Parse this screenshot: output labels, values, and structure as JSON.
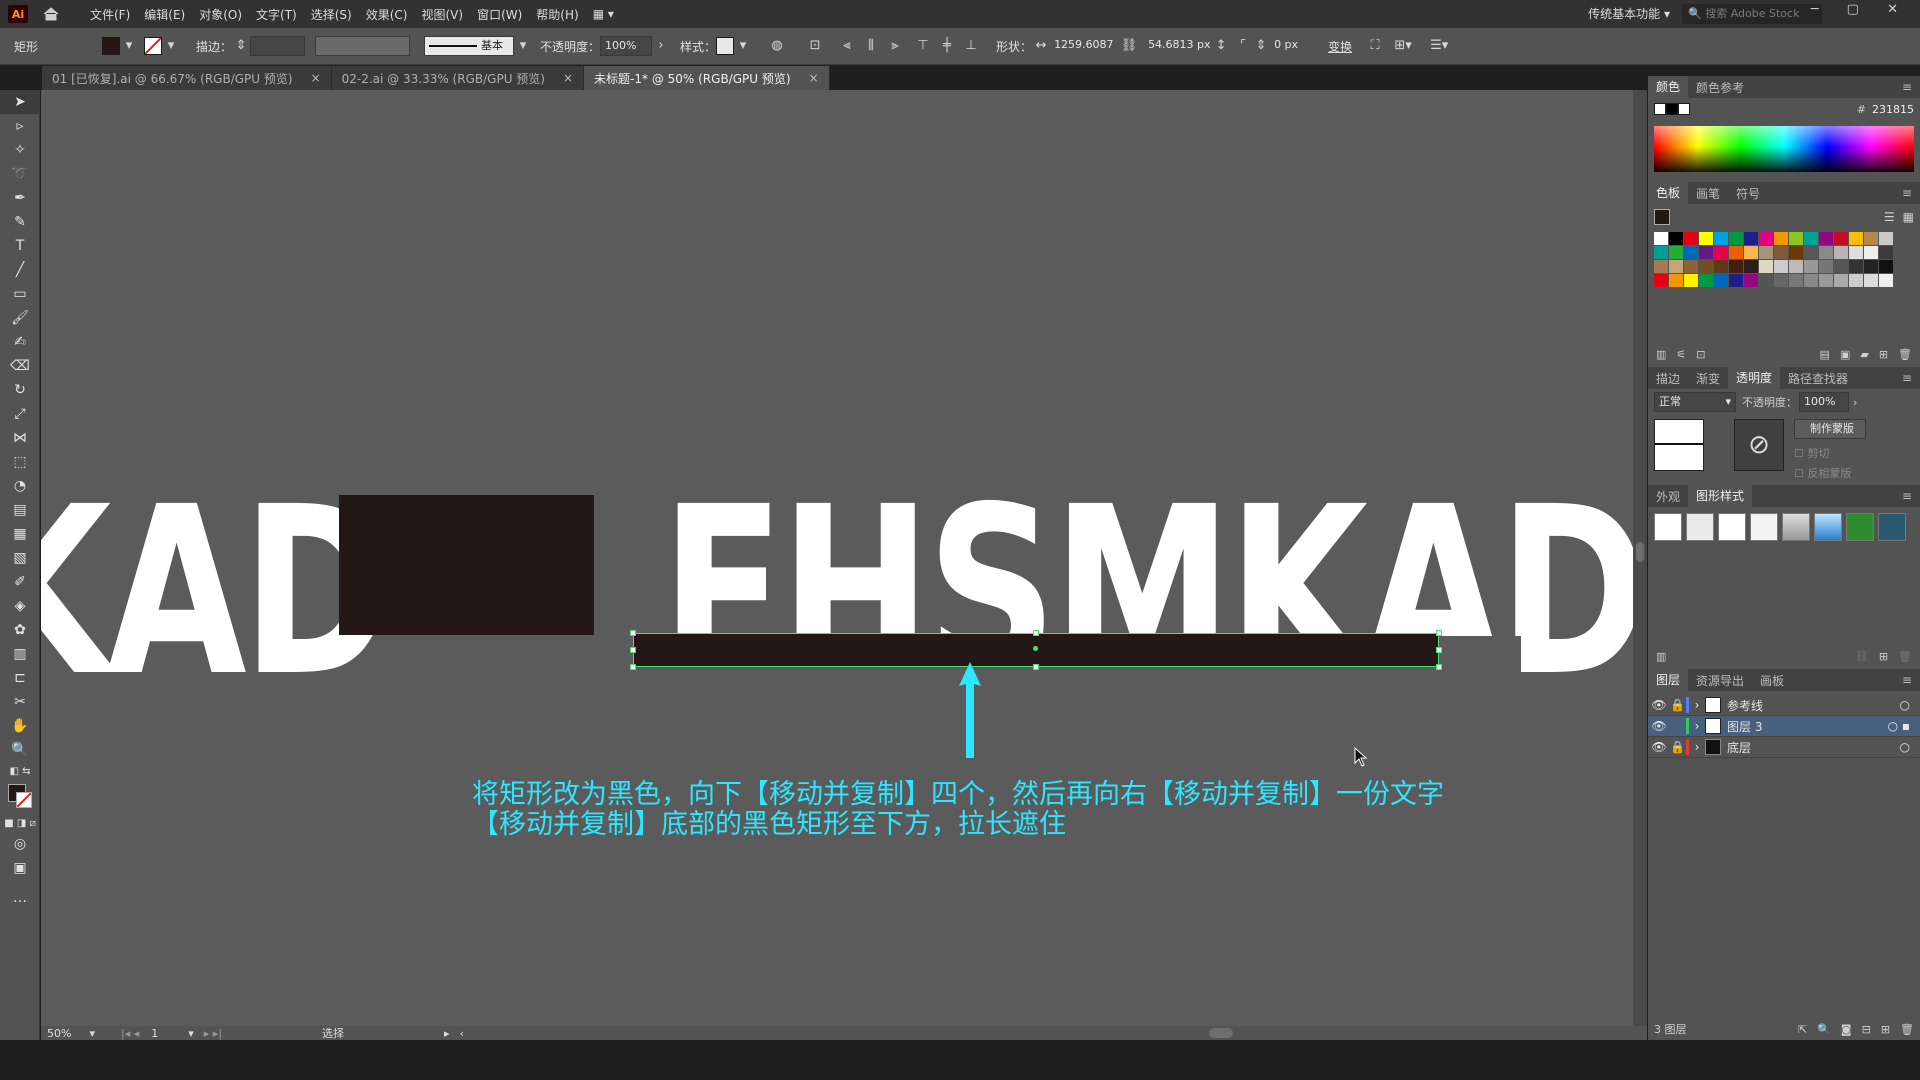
{
  "app": {
    "logo": "Ai",
    "menu": [
      "文件(F)",
      "编辑(E)",
      "对象(O)",
      "文字(T)",
      "选择(S)",
      "效果(C)",
      "视图(V)",
      "窗口(W)",
      "帮助(H)"
    ],
    "workspace": "传统基本功能",
    "search_placeholder": "搜索 Adobe Stock"
  },
  "control_bar": {
    "object_type": "矩形",
    "stroke_label": "描边：",
    "stroke_profile": "基本",
    "opacity_label": "不透明度：",
    "opacity_value": "100%",
    "style_label": "样式：",
    "shape_label": "形状：",
    "width_value": "1259.6087",
    "height_value": "54.6813 px",
    "corner_value": "0 px",
    "transform_label": "变换"
  },
  "tabs": [
    {
      "label": "01 [已恢复].ai @ 66.67% (RGB/GPU 预览)"
    },
    {
      "label": "02-2.ai @ 33.33% (RGB/GPU 预览)"
    },
    {
      "label": "未标题-1* @ 50% (RGB/GPU 预览)"
    }
  ],
  "canvas": {
    "text_left": "KAD",
    "text_main": "FHSMKAD",
    "annotation_line1": "将矩形改为黑色，向下【移动并复制】四个，然后再向右【移动并复制】一份文字",
    "annotation_line2": "【移动并复制】底部的黑色矩形至下方，拉长遮住"
  },
  "status_bar": {
    "zoom": "50%",
    "page": "1",
    "mode": "选择"
  },
  "panels": {
    "color": {
      "tabs": [
        "颜色",
        "颜色参考"
      ],
      "hex": "231815"
    },
    "swatches": {
      "tabs": [
        "色板",
        "画笔",
        "符号"
      ]
    },
    "transparency": {
      "tabs": [
        "描边",
        "渐变",
        "透明度",
        "路径查找器"
      ],
      "blend_mode": "正常",
      "opacity_label": "不透明度：",
      "opacity_value": "100%",
      "make_mask": "制作蒙版",
      "clip": "剪切",
      "invert": "反相蒙版"
    },
    "appearance": {
      "tabs": [
        "外观",
        "图形样式"
      ]
    },
    "layers": {
      "tabs": [
        "图层",
        "资源导出",
        "画板"
      ],
      "items": [
        {
          "name": "参考线",
          "color": "#4f7fff"
        },
        {
          "name": "图层 3",
          "color": "#38c95c"
        },
        {
          "name": "底层",
          "color": "#e23a3a"
        }
      ],
      "count": "3 图层"
    }
  },
  "colors": {
    "fill": "#231815",
    "accent_annotation": "#2ee6ff",
    "selection": "#49e07a"
  }
}
